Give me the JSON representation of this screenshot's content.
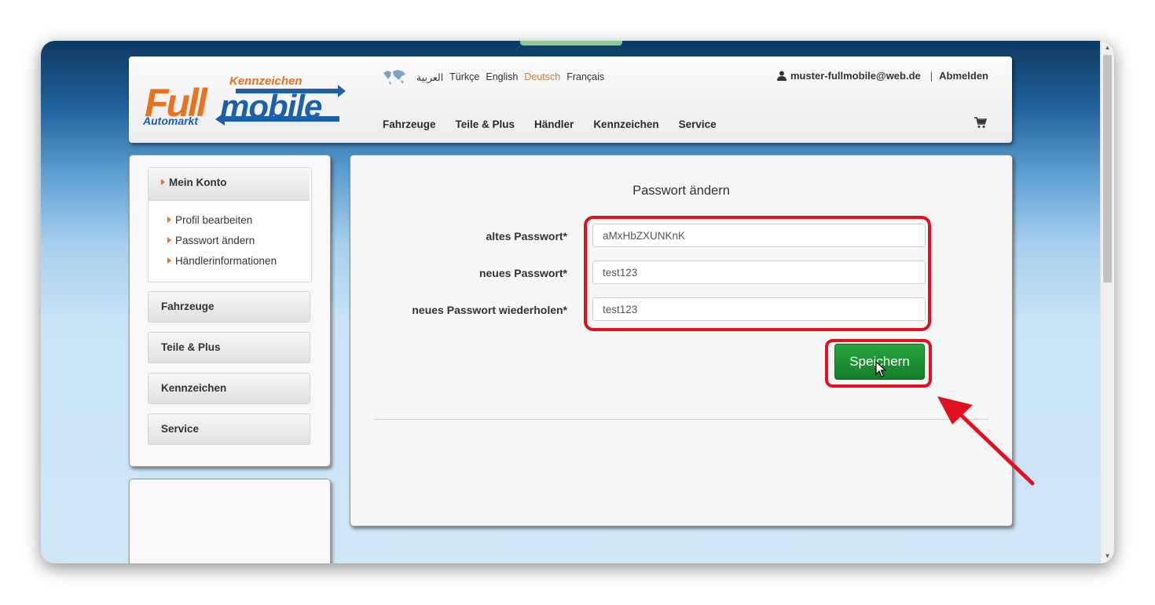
{
  "brand": {
    "logo_main": "Full",
    "logo_mobile": "mobile",
    "logo_top": "Kennzeichen",
    "logo_bottom": "Automarkt"
  },
  "languages": [
    {
      "label": "العربية",
      "active": false
    },
    {
      "label": "Türkçe",
      "active": false
    },
    {
      "label": "English",
      "active": false
    },
    {
      "label": "Deutsch",
      "active": true
    },
    {
      "label": "Français",
      "active": false
    }
  ],
  "user": {
    "email": "muster-fullmobile@web.de",
    "separator": "|",
    "logout_label": "Abmelden"
  },
  "nav": {
    "items": [
      "Fahrzeuge",
      "Teile & Plus",
      "Händler",
      "Kennzeichen",
      "Service"
    ]
  },
  "sidebar": {
    "account_label": "Mein Konto",
    "sub_items": [
      "Profil bearbeiten",
      "Passwort ändern",
      "Händlerinformationen"
    ],
    "sections": [
      "Fahrzeuge",
      "Teile & Plus",
      "Kennzeichen",
      "Service"
    ]
  },
  "form": {
    "title": "Passwort ändern",
    "old_password_label": "altes Passwort*",
    "old_password_value": "aMxHbZXUNKnK",
    "new_password_label": "neues Passwort*",
    "new_password_value": "test123",
    "repeat_password_label": "neues Passwort wiederholen*",
    "repeat_password_value": "test123",
    "save_label": "Speichern"
  },
  "colors": {
    "accent_orange": "#e8731e",
    "brand_blue": "#1d5fa8",
    "save_green": "#1d8f33",
    "annotation_red": "#e0101e"
  },
  "icons": {
    "language": "globe-icon",
    "user": "user-icon",
    "cart": "cart-icon",
    "pointer": "cursor-icon"
  }
}
